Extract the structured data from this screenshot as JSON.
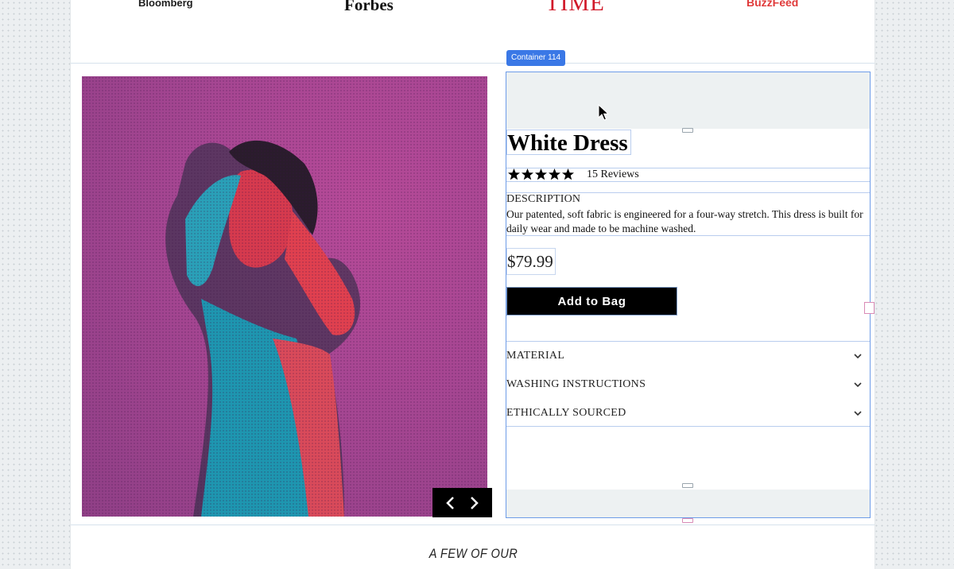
{
  "press_logos": [
    "Bloomberg",
    "Forbes",
    "TIME",
    "BuzzFeed"
  ],
  "editor": {
    "container_tag": "Container 114"
  },
  "product": {
    "title": "White Dress",
    "rating": 5,
    "reviews_label": "15 Reviews",
    "description_label": "DESCRIPTION",
    "description": "Our patented, soft fabric is engineered for a four-way stretch. This dress is built for daily wear and made to be machine washed.",
    "price": "$79.99",
    "add_to_bag_label": "Add to Bag"
  },
  "accordion": [
    {
      "label": "MATERIAL"
    },
    {
      "label": "WASHING INSTRUCTIONS"
    },
    {
      "label": "ETHICALLY SOURCED"
    }
  ],
  "section_heading": "A FEW OF OUR",
  "colors": {
    "image_background": "#a64692",
    "selection_blue": "#3a78e6",
    "time_red": "#d11a2a",
    "buzzfeed_red": "#e03a3a"
  },
  "icons": {
    "star": "star-icon",
    "chevron": "chevron-down-icon",
    "prev": "chevron-left-icon",
    "next": "chevron-right-icon",
    "cursor": "cursor-icon"
  }
}
